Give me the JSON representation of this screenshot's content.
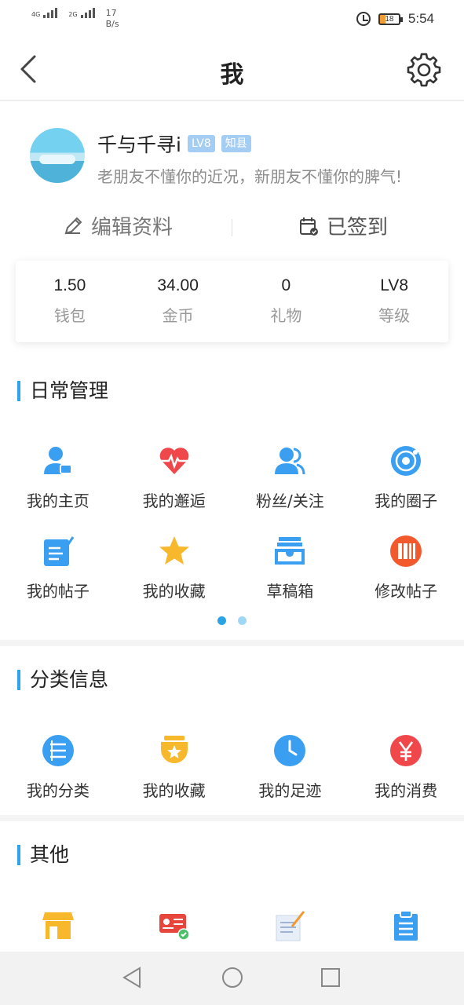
{
  "status_bar": {
    "network1": "4G",
    "network2": "2G",
    "speed_value": "17",
    "speed_unit": "B/s",
    "battery": "18",
    "time": "5:54"
  },
  "nav": {
    "title": "我",
    "back_icon": "back-chevron",
    "settings_icon": "gear"
  },
  "profile": {
    "username": "千与千寻i",
    "level_badge": "LV8",
    "title_badge": "知县",
    "signature": "老朋友不懂你的近况，新朋友不懂你的脾气!",
    "edit_label": "编辑资料",
    "signed_label": "已签到"
  },
  "stats": [
    {
      "value": "1.50",
      "label": "钱包"
    },
    {
      "value": "34.00",
      "label": "金币"
    },
    {
      "value": "0",
      "label": "礼物"
    },
    {
      "value": "LV8",
      "label": "等级"
    }
  ],
  "daily": {
    "title": "日常管理",
    "items": [
      {
        "label": "我的主页",
        "icon": "user-home"
      },
      {
        "label": "我的邂逅",
        "icon": "heart-pulse"
      },
      {
        "label": "粉丝/关注",
        "icon": "fans"
      },
      {
        "label": "我的圈子",
        "icon": "circle-target"
      },
      {
        "label": "我的帖子",
        "icon": "post-edit"
      },
      {
        "label": "我的收藏",
        "icon": "star"
      },
      {
        "label": "草稿箱",
        "icon": "inbox-tray"
      },
      {
        "label": "修改帖子",
        "icon": "bookshelf"
      }
    ],
    "pages": 2,
    "active_page": 1
  },
  "category": {
    "title": "分类信息",
    "items": [
      {
        "label": "我的分类",
        "icon": "list"
      },
      {
        "label": "我的收藏",
        "icon": "star-jar"
      },
      {
        "label": "我的足迹",
        "icon": "clock"
      },
      {
        "label": "我的消费",
        "icon": "yen"
      }
    ]
  },
  "other": {
    "title": "其他",
    "items": [
      {
        "icon": "shop"
      },
      {
        "icon": "id-card-check"
      },
      {
        "icon": "notepad"
      },
      {
        "icon": "clipboard"
      }
    ]
  },
  "colors": {
    "accent": "#2aa3e6",
    "icon_blue": "#3a9ff0",
    "icon_red": "#f0474b",
    "icon_yellow": "#f7b82b",
    "icon_orange": "#f25a2e"
  }
}
